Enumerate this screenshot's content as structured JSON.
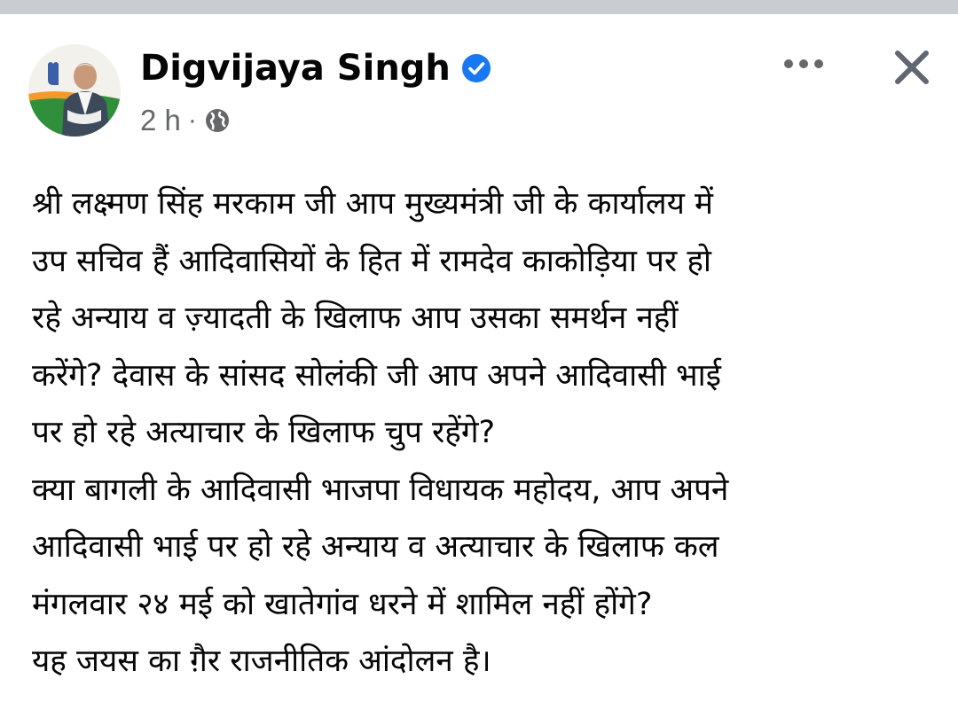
{
  "post": {
    "author": {
      "name": "Digvijaya Singh",
      "verified": true,
      "avatar_icon": "profile-photo"
    },
    "meta": {
      "time": "2 h",
      "separator": "·",
      "audience_icon": "globe-icon"
    },
    "header_actions": {
      "more_icon": "more-dots-icon",
      "close_icon": "close-icon"
    },
    "text_lines": [
      "श्री लक्ष्मण सिंह मरकाम जी आप मुख्यमंत्री जी के कार्यालय में",
      "उप सचिव हैं आदिवासियों के हित में रामदेव काकोड़िया पर हो",
      "रहे अन्याय व ज़्यादती के खिलाफ आप उसका समर्थन नहीं",
      "करेंगे? देवास के सांसद सोलंकी जी आप अपने आदिवासी भाई",
      "पर हो रहे अत्याचार के खिलाफ चुप रहेंगे?",
      "क्या बागली के आदिवासी भाजपा विधायक महोदय, आप अपने",
      "आदिवासी भाई पर हो रहे अन्याय व अत्याचार के खिलाफ कल",
      "मंगलवार २४ मई को खातेगांव धरने में शामिल नहीं होंगे?",
      "यह जयस का ग़ैर राजनीतिक आंदोलन है।"
    ]
  },
  "colors": {
    "verified_blue": "#1877f2",
    "meta_gray": "#65676b",
    "text_black": "#050505",
    "top_strip": "#c9ccd1"
  }
}
